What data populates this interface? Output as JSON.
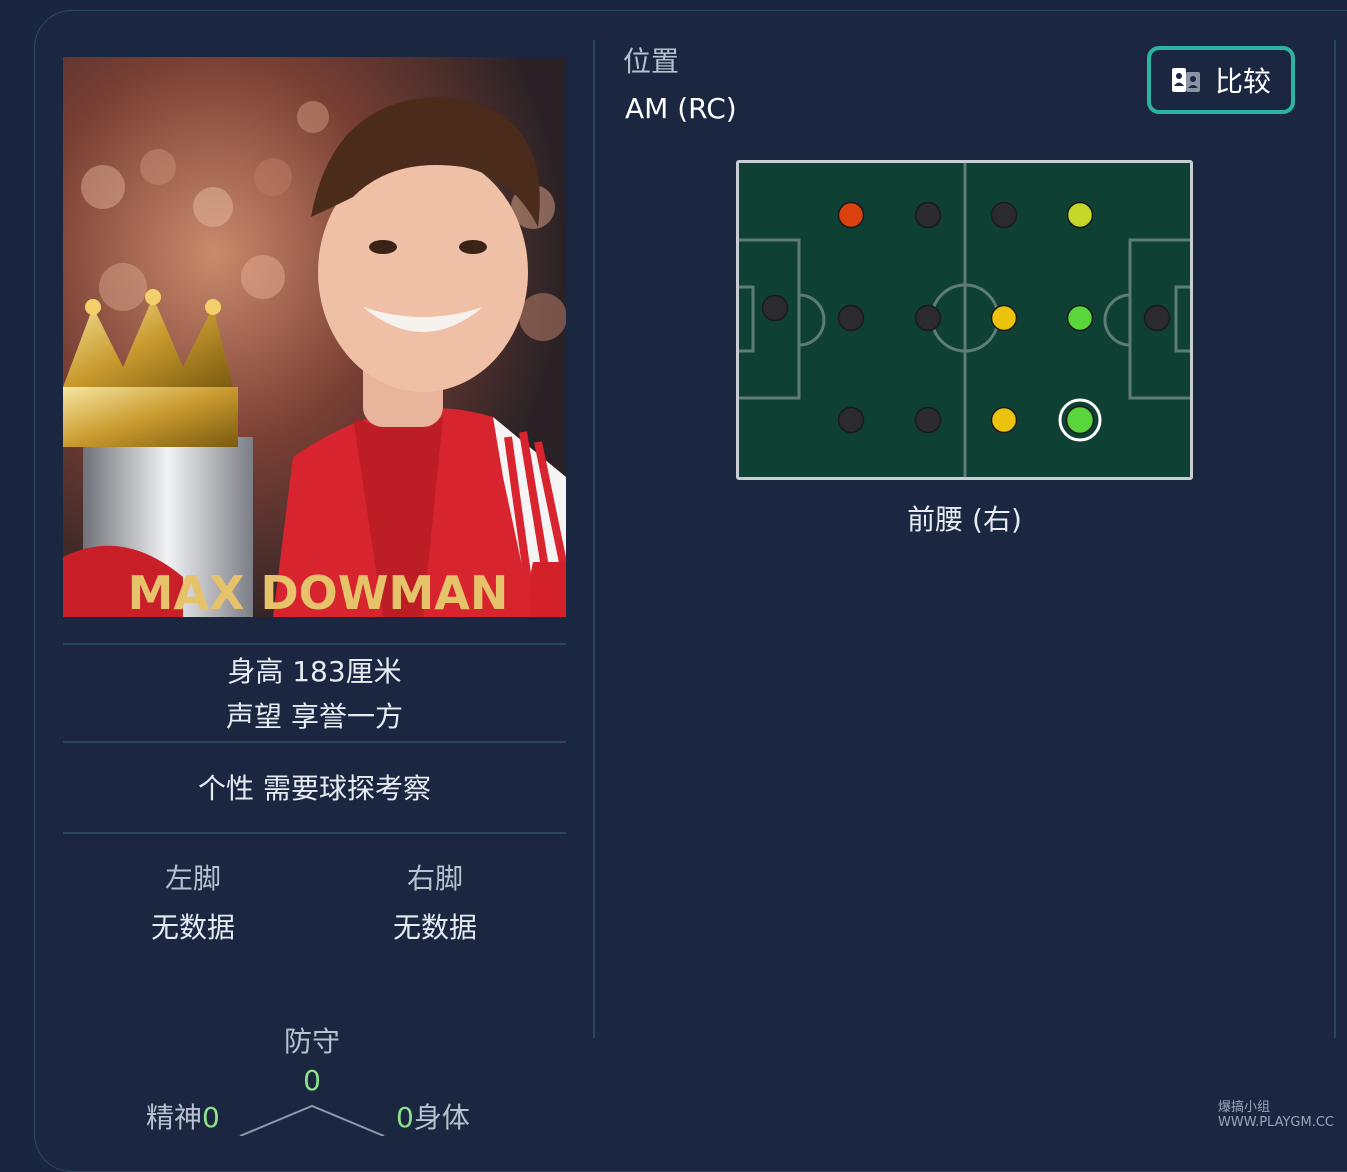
{
  "player": {
    "name_on_photo": "MAX DOWMAN",
    "height_label": "身高",
    "height_value": "183厘米",
    "reputation_label": "声望",
    "reputation_value": "享誉一方",
    "personality_label": "个性",
    "personality_value": "需要球探考察",
    "left_foot_label": "左脚",
    "left_foot_value": "无数据",
    "right_foot_label": "右脚",
    "right_foot_value": "无数据"
  },
  "attributes": {
    "defense_label": "防守",
    "defense_value": "0",
    "mental_label": "精神",
    "mental_value": "0",
    "physical_label": "身体",
    "physical_value": "0"
  },
  "position": {
    "section_title": "位置",
    "code": "AM (RC)",
    "name": "前腰 (右)",
    "compare_label": "比较"
  },
  "colors": {
    "accent": "#2bb3a3",
    "pitch": "#0f4034",
    "dot_none": "#2b2b2f",
    "dot_red": "#d9420f",
    "dot_lime": "#c4d82a",
    "dot_yellow": "#ecc30c",
    "dot_green": "#59d63b"
  },
  "watermark": "爆搞小组 WWW.PLAYGM.CC"
}
